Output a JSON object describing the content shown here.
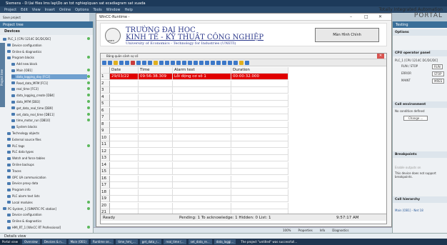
{
  "tia": {
    "window_title": "Siemens - D:\\lai files lms lap\\Do an tot nghiep\\quan sat ecadiagram sat xuada",
    "menu": [
      "Project",
      "Edit",
      "View",
      "Insert",
      "Online",
      "Options",
      "Tools",
      "Window",
      "Help"
    ],
    "brand_line1": "Totally Integrated Automation",
    "brand_line2": "PORTAL",
    "toolbar_label": "Save project",
    "project_tree_title": "Project tree",
    "devices_tab": "Devices",
    "vertical_tab": "Project tree",
    "tree": [
      {
        "label": "PLC_1 [CPU 1214C DC/DC/DC]",
        "indent": 4,
        "selected": false,
        "ok": true
      },
      {
        "label": "Device configuration",
        "indent": 10,
        "selected": false,
        "ok": false
      },
      {
        "label": "Online & diagnostics",
        "indent": 10,
        "selected": false,
        "ok": false
      },
      {
        "label": "Program blocks",
        "indent": 10,
        "selected": false,
        "ok": true
      },
      {
        "label": "Add new block",
        "indent": 16,
        "selected": false,
        "ok": false
      },
      {
        "label": "Main [OB1]",
        "indent": 16,
        "selected": false,
        "ok": true
      },
      {
        "label": "data_logging_day [FC2]",
        "indent": 16,
        "selected": true,
        "ok": true
      },
      {
        "label": "Read_data_MFM [FC1]",
        "indent": 16,
        "selected": false,
        "ok": true
      },
      {
        "label": "real_time [FC3]",
        "indent": 16,
        "selected": false,
        "ok": true
      },
      {
        "label": "data_logging_create [DB4]",
        "indent": 16,
        "selected": false,
        "ok": true
      },
      {
        "label": "data_MFM [DB3]",
        "indent": 16,
        "selected": false,
        "ok": true
      },
      {
        "label": "get_data_real_time [DB9]",
        "indent": 16,
        "selected": false,
        "ok": true
      },
      {
        "label": "set_data_real_time [DB11]",
        "indent": 16,
        "selected": false,
        "ok": true
      },
      {
        "label": "time_motor_run [DB10]",
        "indent": 16,
        "selected": false,
        "ok": true
      },
      {
        "label": "System blocks",
        "indent": 16,
        "selected": false,
        "ok": false
      },
      {
        "label": "Technology objects",
        "indent": 10,
        "selected": false,
        "ok": false
      },
      {
        "label": "External source files",
        "indent": 10,
        "selected": false,
        "ok": false
      },
      {
        "label": "PLC tags",
        "indent": 10,
        "selected": false,
        "ok": true
      },
      {
        "label": "PLC data types",
        "indent": 10,
        "selected": false,
        "ok": false
      },
      {
        "label": "Watch and force tables",
        "indent": 10,
        "selected": false,
        "ok": false
      },
      {
        "label": "Online backups",
        "indent": 10,
        "selected": false,
        "ok": false
      },
      {
        "label": "Traces",
        "indent": 10,
        "selected": false,
        "ok": false
      },
      {
        "label": "OPC UA communication",
        "indent": 10,
        "selected": false,
        "ok": false
      },
      {
        "label": "Device proxy data",
        "indent": 10,
        "selected": false,
        "ok": false
      },
      {
        "label": "Program info",
        "indent": 10,
        "selected": false,
        "ok": false
      },
      {
        "label": "PLC alarm text lists",
        "indent": 10,
        "selected": false,
        "ok": false
      },
      {
        "label": "Local modules",
        "indent": 10,
        "selected": false,
        "ok": true
      },
      {
        "label": "PC-System_1 [SIMATIC PC station]",
        "indent": 4,
        "selected": false,
        "ok": true
      },
      {
        "label": "Device configuration",
        "indent": 10,
        "selected": false,
        "ok": false
      },
      {
        "label": "Online & diagnostics",
        "indent": 10,
        "selected": false,
        "ok": false
      },
      {
        "label": "HMI_RT_1 [WinCC RT Professional]",
        "indent": 10,
        "selected": false,
        "ok": true
      }
    ],
    "details_view": "Details view",
    "portal_view": "Portal view",
    "overview": "Overview",
    "tabs_bottom": [
      "Properties",
      "Info",
      "Diagnostics"
    ],
    "zoom": "100%",
    "status_msg": "The project \"untitled\" was successfull...",
    "taskbar": [
      "Devices & n...",
      "Main (OB1)",
      "Runtime se...",
      "time_hmi_...",
      "get_data_r...",
      "real_time (...",
      "set_data_re...",
      "data_loggi..."
    ]
  },
  "right": {
    "panel_title": "Testing",
    "options": "Options",
    "cpu_panel": "CPU operator panel",
    "cpu_name": "PLC_1 [CPU 1214C DC/DC/DC]",
    "run_stop": "RUN / STOP",
    "run_btn": "RUN",
    "error": "ERROR",
    "stop_btn": "STOP",
    "maint": "MAINT",
    "mres_btn": "MRES",
    "call_env": "Call environment",
    "no_cond": "No condition defined",
    "change_btn": "Change ...",
    "breakpoints": "Breakpoints",
    "enable_bp": "Enable outputs on",
    "bp_msg": "This device does not support breakpoints.",
    "call_hier": "Call hierarchy",
    "call_hier_item": "Main [OB1] - Net 18"
  },
  "wincc": {
    "title": "WinCC-Runtime -",
    "title1": "TRƯỜNG ĐẠI HỌC",
    "title2": "KINH TẾ - KỸ THUẬT CÔNG NGHIỆP",
    "title3": "University of Economics - Technology for Industries (UNETI)",
    "logo_text": "UNETI",
    "main_button": "Màn Hình Chính",
    "alarm_title": "Bảng quản cảnh sự cố",
    "columns": [
      "Date",
      "Time",
      "Alarm text",
      "Duration"
    ],
    "rows": [
      {
        "date": "29/03/22",
        "time": "09:56:38.309",
        "text": "Lỗi động cơ số 1",
        "duration": "00:00:32.000"
      }
    ],
    "row_numbers": [
      "1",
      "2",
      "3",
      "4",
      "5",
      "6",
      "7",
      "8",
      "9",
      "10",
      "11",
      "12",
      "13",
      "14",
      "15",
      "16",
      "17",
      "18",
      "19",
      "20",
      "21"
    ],
    "status_ready": "Ready",
    "status_pending": "Pending: 1  To acknowledge: 1  Hidden: 0  List: 1",
    "status_time": "9:57:17 AM"
  }
}
